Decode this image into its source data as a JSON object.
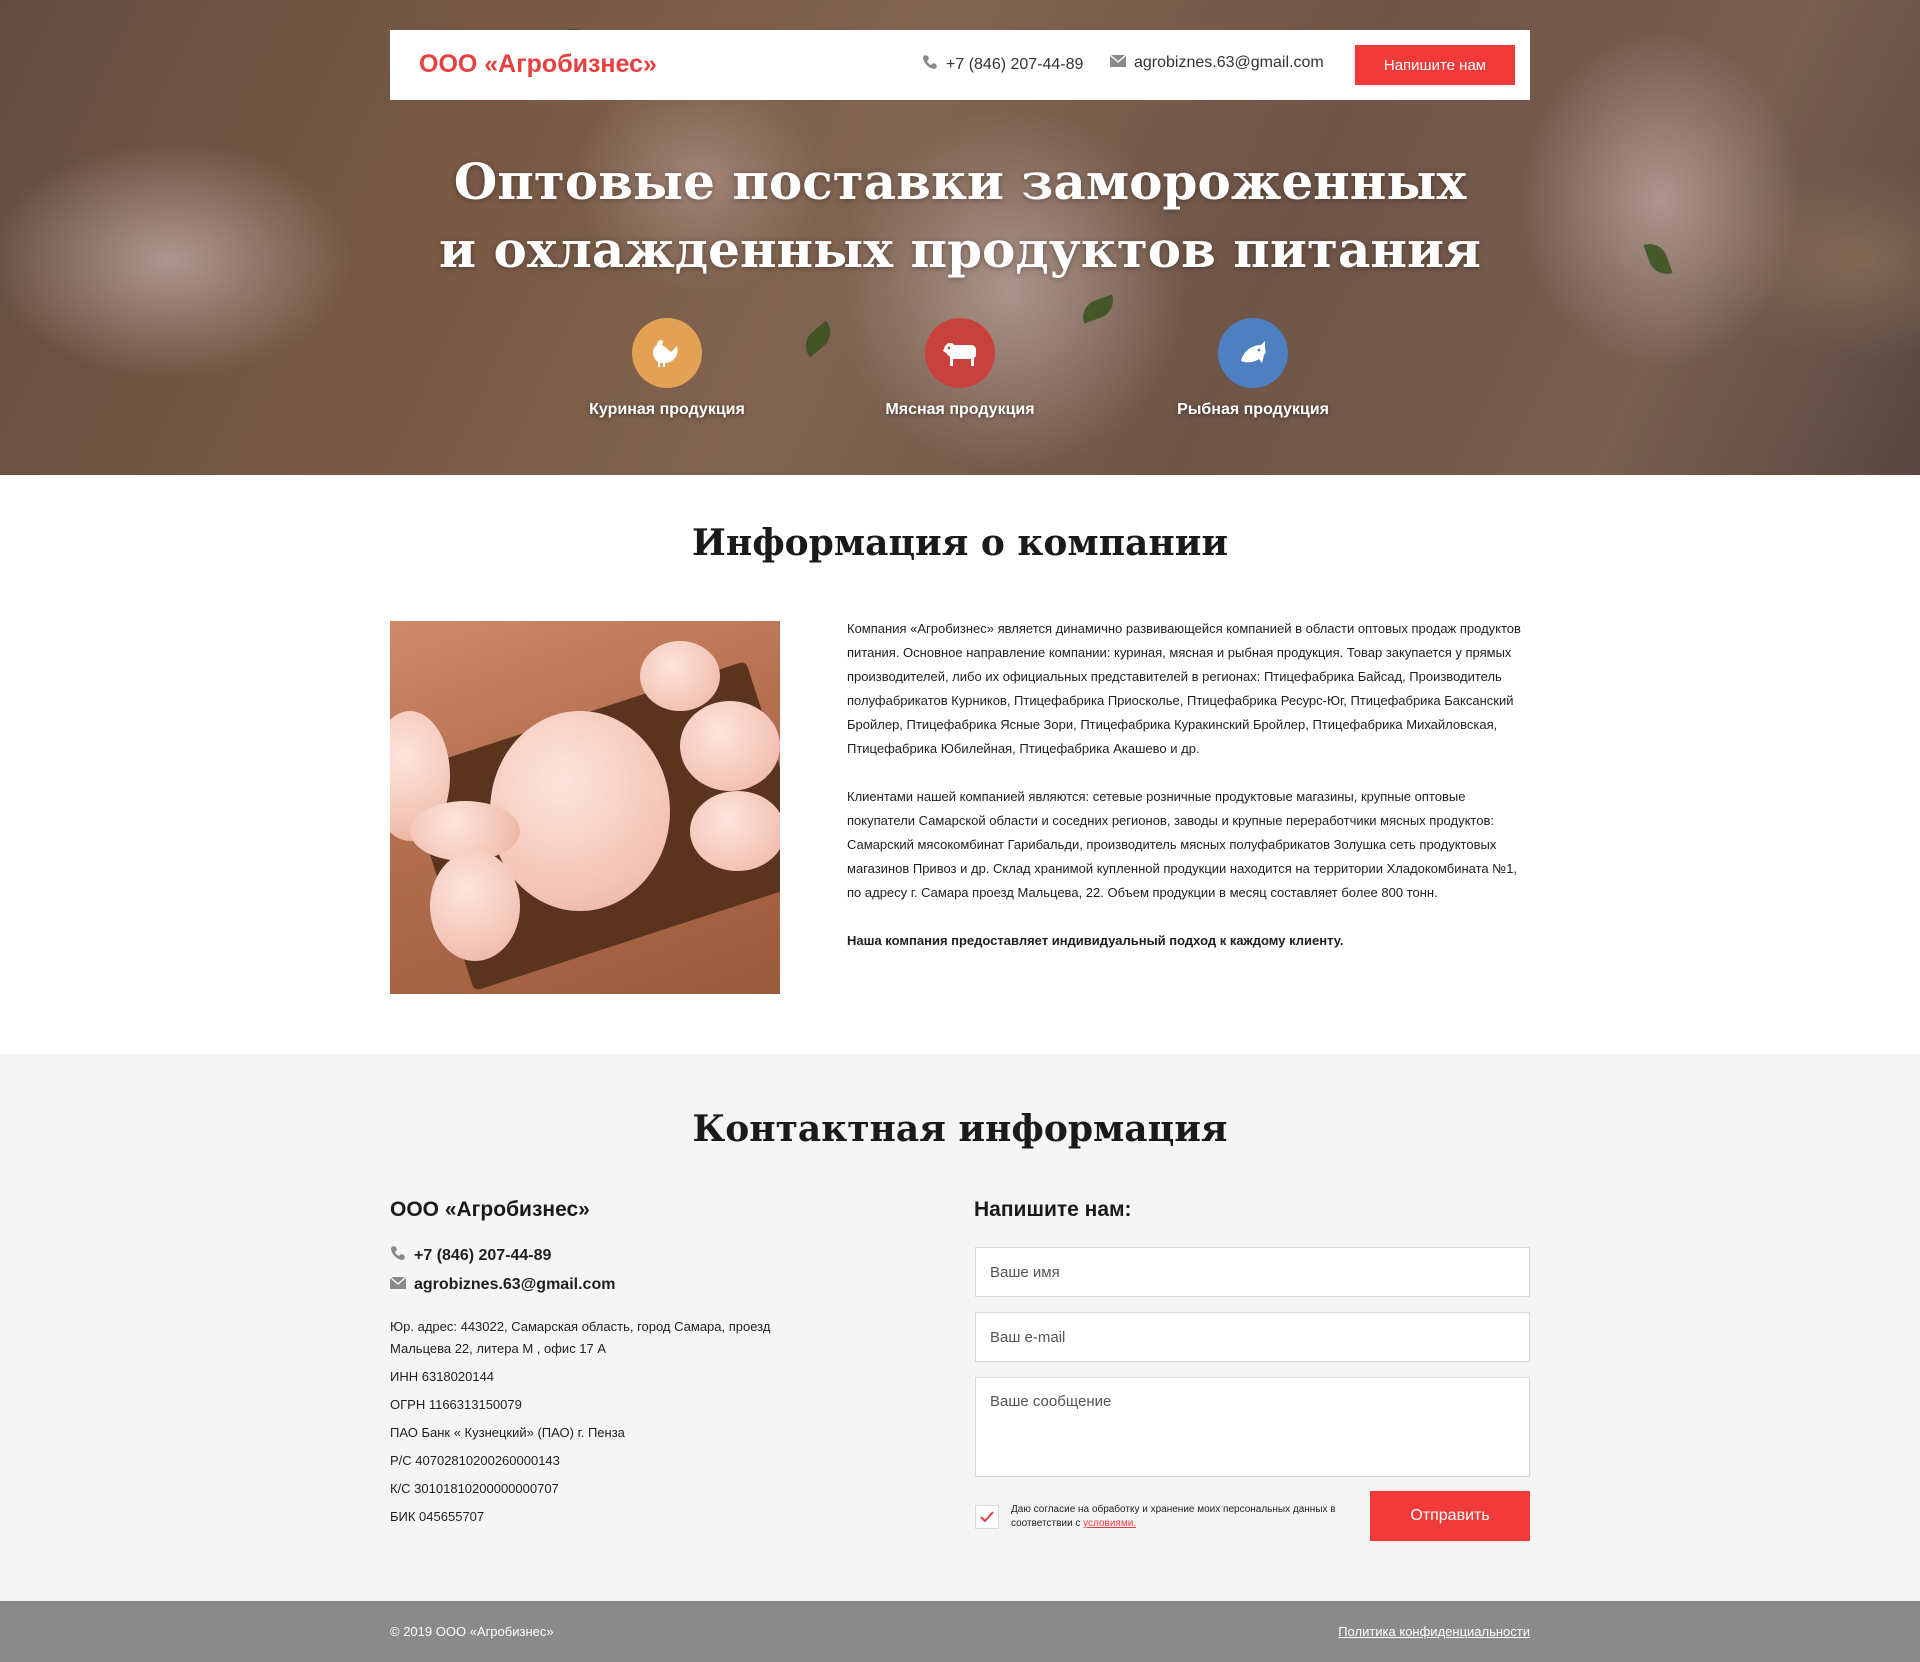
{
  "header": {
    "brand": "ООО «Агробизнес»",
    "phone": "+7 (846) 207-44-89",
    "email": "agrobiznes.63@gmail.com",
    "cta_label": "Напишите нам"
  },
  "hero": {
    "title_line1": "Оптовые поставки замороженных",
    "title_line2": "и охлажденных продуктов питания",
    "categories": [
      {
        "label": "Куриная продукция",
        "icon": "chicken-icon",
        "color": "#e3a155"
      },
      {
        "label": "Мясная продукция",
        "icon": "cow-icon",
        "color": "#c8413d"
      },
      {
        "label": "Рыбная продукция",
        "icon": "fish-icon",
        "color": "#4e7fc1"
      }
    ]
  },
  "about": {
    "title": "Информация о компании",
    "paragraph1": "Компания «Агробизнес» является динамично развивающейся компанией в области оптовых продаж продуктов питания. Основное направление компании: куриная, мясная и рыбная продукция. Товар закупается у прямых производителей, либо их официальных  представителей в регионах: Птицефабрика Байсад, Производитель полуфабрикатов Курников, Птицефабрика Приосколье, Птицефабрика Ресурс-Юг, Птицефабрика Баксанский Бройлер, Птицефабрика Ясные Зори, Птицефабрика Куракинский Бройлер, Птицефабрика Михайловская, Птицефабрика Юбилейная, Птицефабрика Акашево и др.",
    "paragraph2": "Клиентами нашей компанией являются: сетевые розничные продуктовые магазины, крупные оптовые покупатели Самарской области и соседних регионов, заводы и крупные переработчики мясных продуктов: Самарский мясокомбинат Гарибальди, производитель мясных полуфабрикатов Золушка сеть продуктовых магазинов Привоз и др. Склад хранимой купленной продукции находится на территории Хладокомбината №1, по адресу г. Самара проезд Мальцева, 22. Объем продукции в месяц составляет более 800 тонн.",
    "highlight": "Наша компания предоставляет индивидуальный подход к каждому клиенту."
  },
  "contacts": {
    "title": "Контактная информация",
    "company": "ООО «Агробизнес»",
    "phone": "+7 (846) 207-44-89",
    "email": "agrobiznes.63@gmail.com",
    "address": "Юр. адрес: 443022, Самарская область, город Самара, проезд Мальцева 22, литера М , офис 17 А",
    "inn": "ИНН 6318020144",
    "ogrn": "ОГРН 1166313150079",
    "bank": "ПАО Банк « Кузнецкий» (ПАО) г. Пенза",
    "rs": "Р/С 40702810200260000143",
    "ks": "К/С 30101810200000000707",
    "bik": "БИК 045655707"
  },
  "form": {
    "title": "Напишите нам:",
    "name_placeholder": "Ваше имя",
    "email_placeholder": "Ваш e-mail",
    "message_placeholder": "Ваше сообщение",
    "consent_text": "Даю согласие на обработку и хранение моих персональных данных в соответствии с",
    "consent_link": "условиями.",
    "consent_checked": true,
    "submit_label": "Отправить"
  },
  "footer": {
    "copyright": "© 2019 ООО «Агробизнес»",
    "privacy_link": "Политика конфиденциальности"
  },
  "colors": {
    "accent": "#f23a3a",
    "brand_text": "#e83f3f",
    "footer_bg": "#8a8a8a",
    "contacts_bg": "#f5f5f5"
  }
}
